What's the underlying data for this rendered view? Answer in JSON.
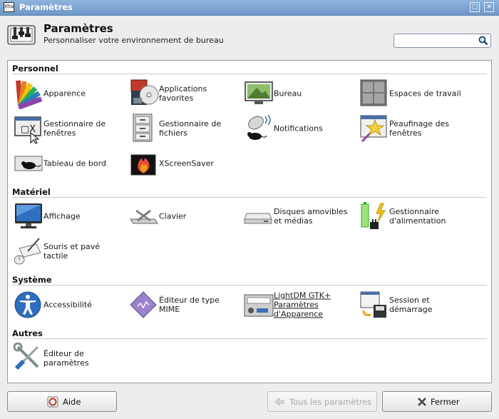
{
  "window": {
    "title": "Paramètres",
    "icon_text": "Xfce"
  },
  "header": {
    "title": "Paramètres",
    "subtitle": "Personnaliser votre environnement de bureau"
  },
  "search": {
    "value": "",
    "placeholder": ""
  },
  "sections": {
    "personnel": {
      "title": "Personnel",
      "items": [
        {
          "label": "Apparence",
          "icon": "palette-icon"
        },
        {
          "label": "Applications favorites",
          "icon": "multimedia-icon"
        },
        {
          "label": "Bureau",
          "icon": "desktop-icon"
        },
        {
          "label": "Espaces de travail",
          "icon": "workspaces-icon"
        },
        {
          "label": "Gestionnaire de fenêtres",
          "icon": "window-manager-icon"
        },
        {
          "label": "Gestionnaire de fichiers",
          "icon": "file-cabinet-icon"
        },
        {
          "label": "Notifications",
          "icon": "notification-mouse-icon"
        },
        {
          "label": "Peaufinage des fenêtres",
          "icon": "star-wand-icon"
        },
        {
          "label": "Tableau de bord",
          "icon": "panel-mouse-icon"
        },
        {
          "label": "XScreenSaver",
          "icon": "screensaver-icon"
        }
      ]
    },
    "materiel": {
      "title": "Matériel",
      "items": [
        {
          "label": "Affichage",
          "icon": "monitor-icon"
        },
        {
          "label": "Clavier",
          "icon": "keyboard-icon"
        },
        {
          "label": "Disques amovibles et médias",
          "icon": "drive-icon"
        },
        {
          "label": "Gestionnaire d'alimentation",
          "icon": "battery-icon"
        },
        {
          "label": "Souris et pavé tactile",
          "icon": "mouse-icon"
        }
      ]
    },
    "systeme": {
      "title": "Système",
      "items": [
        {
          "label": "Accessibilité",
          "icon": "accessibility-icon"
        },
        {
          "label": "Éditeur de type MIME",
          "icon": "mime-icon"
        },
        {
          "label": "LightDM GTK+ Paramètres d'Apparence",
          "icon": "lightdm-icon"
        },
        {
          "label": "Session et démarrage",
          "icon": "session-icon"
        }
      ]
    },
    "autres": {
      "title": "Autres",
      "items": [
        {
          "label": "Éditeur de paramètres",
          "icon": "tools-icon"
        }
      ]
    }
  },
  "footer": {
    "help_label": "Aide",
    "all_settings_label": "Tous les paramètres",
    "close_label": "Fermer"
  }
}
